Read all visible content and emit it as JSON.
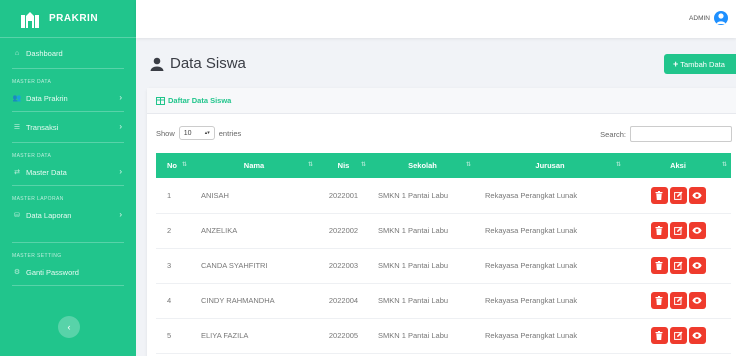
{
  "sidebar": {
    "brand": "PRAKRIN",
    "items": [
      {
        "label": "Dashboard",
        "icon": "home-icon"
      },
      {
        "section": "MASTER DATA",
        "label": "Data Prakrin",
        "icon": "users-icon"
      },
      {
        "label": "Transaksi",
        "icon": "list-icon"
      },
      {
        "section": "MASTER DATA",
        "label": "Master Data",
        "icon": "random-icon"
      },
      {
        "section": "MASTER LAPORAN",
        "label": "Data Laporan",
        "icon": "database-icon"
      },
      {
        "section": "MASTER SETTING",
        "label": "Ganti Password",
        "icon": "cogs-icon"
      }
    ]
  },
  "topbar": {
    "user": "ADMIN"
  },
  "page": {
    "title": "Data Siswa",
    "add_button": "Tambah Data"
  },
  "card": {
    "header": "Daftar Data Siswa",
    "show_label": "Show",
    "entries_value": "10",
    "entries_label": "entries",
    "search_label": "Search:",
    "search_value": ""
  },
  "table": {
    "columns": [
      "No",
      "Nama",
      "Nis",
      "Sekolah",
      "Jurusan",
      "Aksi"
    ],
    "rows": [
      [
        "1",
        "ANISAH",
        "2022001",
        "SMKN 1 Pantai Labu",
        "Rekayasa Perangkat Lunak"
      ],
      [
        "2",
        "ANZELIKA",
        "2022002",
        "SMKN 1 Pantai Labu",
        "Rekayasa Perangkat Lunak"
      ],
      [
        "3",
        "CANDA SYAHFITRI",
        "2022003",
        "SMKN 1 Pantai Labu",
        "Rekayasa Perangkat Lunak"
      ],
      [
        "4",
        "CINDY RAHMANDHA",
        "2022004",
        "SMKN 1 Pantai Labu",
        "Rekayasa Perangkat Lunak"
      ],
      [
        "5",
        "ELIYA FAZILA",
        "2022005",
        "SMKN 1 Pantai Labu",
        "Rekayasa Perangkat Lunak"
      ]
    ]
  },
  "colors": {
    "accent": "#21c58c",
    "danger": "#ef3b2d",
    "avatar": "#1e90ff"
  }
}
